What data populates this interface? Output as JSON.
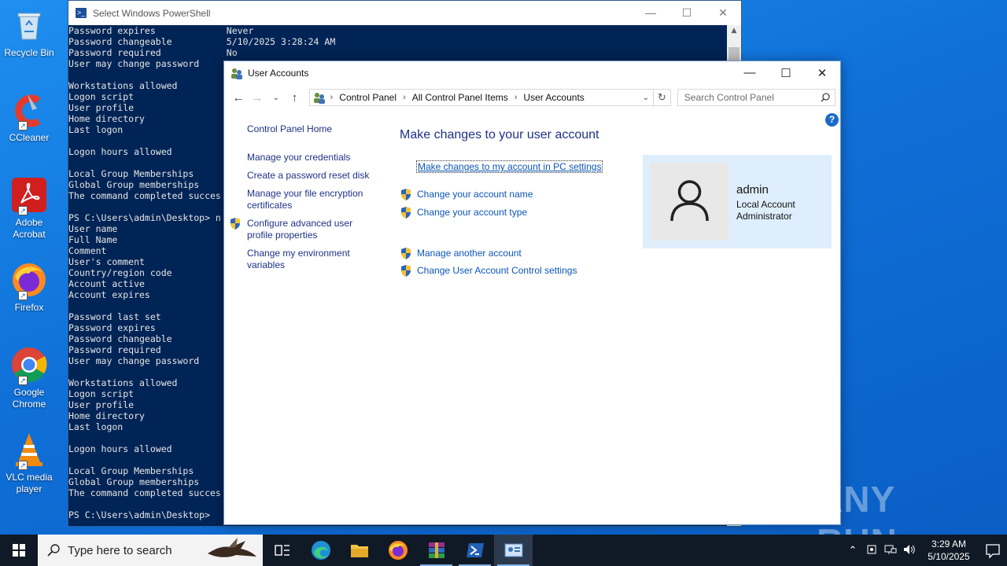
{
  "desktop": {
    "icons": [
      {
        "label": "Recycle Bin",
        "icon": "recycle-bin-icon"
      },
      {
        "label": "CCleaner",
        "icon": "ccleaner-icon"
      },
      {
        "label": "Adobe Acrobat",
        "icon": "adobe-acrobat-icon"
      },
      {
        "label": "Firefox",
        "icon": "firefox-icon"
      },
      {
        "label": "Google Chrome",
        "icon": "chrome-icon"
      },
      {
        "label": "VLC media player",
        "icon": "vlc-icon"
      }
    ]
  },
  "powershell": {
    "title": "Select Windows PowerShell",
    "lines": [
      "Password expires             Never",
      "Password changeable          5/10/2025 3:28:24 AM",
      "Password required            No",
      "User may change password",
      "",
      "Workstations allowed",
      "Logon script",
      "User profile",
      "Home directory",
      "Last logon",
      "",
      "Logon hours allowed",
      "",
      "Local Group Memberships",
      "Global Group memberships",
      "The command completed succes",
      "",
      "PS C:\\Users\\admin\\Desktop> n",
      "User name",
      "Full Name",
      "Comment",
      "User's comment",
      "Country/region code",
      "Account active",
      "Account expires",
      "",
      "Password last set",
      "Password expires",
      "Password changeable",
      "Password required",
      "User may change password",
      "",
      "Workstations allowed",
      "Logon script",
      "User profile",
      "Home directory",
      "Last logon",
      "",
      "Logon hours allowed",
      "",
      "Local Group Memberships",
      "Global Group memberships",
      "The command completed succes",
      "",
      "PS C:\\Users\\admin\\Desktop>"
    ]
  },
  "user_accounts": {
    "title": "User Accounts",
    "breadcrumb": [
      "Control Panel",
      "All Control Panel Items",
      "User Accounts"
    ],
    "search_placeholder": "Search Control Panel",
    "help": "?",
    "left_pane": {
      "home": "Control Panel Home",
      "manage_credentials": "Manage your credentials",
      "reset_disk": "Create a password reset disk",
      "file_encryption": "Manage your file encryption certificates",
      "advanced_profile": "Configure advanced user profile properties",
      "environment_vars": "Change my environment variables"
    },
    "main": {
      "heading": "Make changes to your user account",
      "pc_settings_link": "Make changes to my account in PC settings",
      "change_name": "Change your account name",
      "change_type": "Change your account type",
      "manage_another": "Manage another account",
      "uac_settings": "Change User Account Control settings"
    },
    "user": {
      "name": "admin",
      "type": "Local Account",
      "role": "Administrator"
    }
  },
  "watermark": "ANY RUN",
  "taskbar": {
    "search_placeholder": "Type here to search",
    "time": "3:29 AM",
    "date": "5/10/2025"
  },
  "colors": {
    "desktop": "#0f70d8",
    "powershell_bg": "#012456",
    "link": "#0b55b8",
    "heading": "#1e3287",
    "user_card": "#dfeefc"
  }
}
